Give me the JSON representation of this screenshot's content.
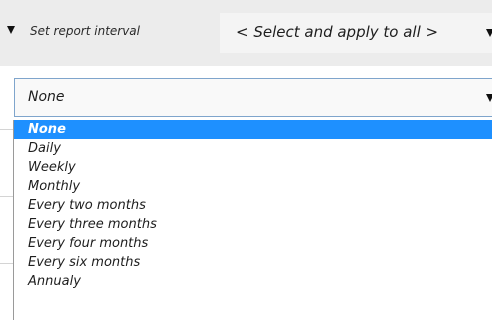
{
  "header": {
    "label": "Set report interval",
    "apply_all_placeholder": "< Select and apply to all >"
  },
  "interval_select": {
    "value": "None"
  },
  "dropdown": {
    "selected_index": 0,
    "options": [
      "None",
      "Daily",
      "Weekly",
      "Monthly",
      "Every two months",
      "Every three months",
      "Every four months",
      "Every six months",
      "Annualy"
    ]
  },
  "colors": {
    "selected_option_bg": "#1e90ff",
    "select_border": "#7fa5cc",
    "header_bg": "#ececec"
  },
  "icons": {
    "collapse": "triangle-down",
    "dropdown": "triangle-down"
  }
}
